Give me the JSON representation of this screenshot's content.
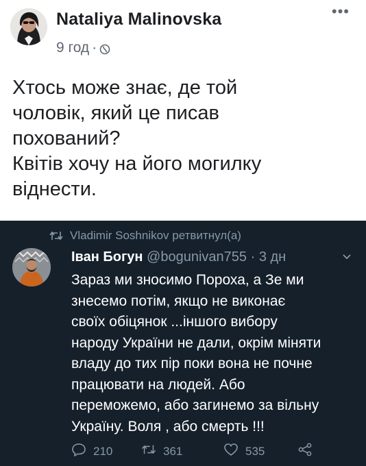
{
  "post": {
    "author_name": "Nataliya Malinovska",
    "time": "9 год",
    "separator": "·",
    "more_glyph": "•••",
    "text": "Хтось може знає, де той\nчоловік, який це писав\nпохований?\nКвітів хочу на його могилку\nвіднести.",
    "icons": {
      "avatar": "profile-photo",
      "privacy": "globe-icon",
      "more": "more-dots-icon"
    }
  },
  "tweet": {
    "retweeted_by": "Vladimir Soshnikov ретвитнул(а)",
    "author_name": "Іван Богун",
    "handle": "@bogunivan755",
    "time_sep": "·",
    "time": "3 дн",
    "text": "Зараз ми зносимо Пороха, а Зе ми\nзнесемо потім, якщо не виконає\nсвоїх обіцянок ...іншого вибору\nнароду України не дали, окрім міняти\nвладу до тих пір поки вона не почне\nпрацювати на людей. Або\nпереможемо, або загинемо за вільну\nУкраїну. Воля , або смерть !!!",
    "replies": "210",
    "retweets": "361",
    "likes": "535",
    "icons": {
      "retweet": "retweet-icon",
      "reply": "reply-icon",
      "like": "heart-icon",
      "share": "share-icon",
      "menu": "chevron-down-icon"
    },
    "colors": {
      "background": "#15202b",
      "secondary": "#8899a6",
      "primary": "#ffffff"
    }
  }
}
